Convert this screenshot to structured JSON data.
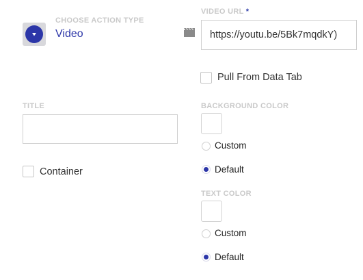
{
  "action_type": {
    "label": "CHOOSE ACTION TYPE",
    "value": "Video",
    "icon": "chevron-down-icon"
  },
  "video_url": {
    "label": "VIDEO URL",
    "required_marker": "*",
    "value": "https://youtu.be/5Bk7mqdkY)",
    "icon": "film-icon"
  },
  "pull_from_data_tab": {
    "label": "Pull From Data Tab",
    "checked": false
  },
  "title": {
    "label": "TITLE",
    "value": ""
  },
  "container": {
    "label": "Container",
    "checked": false
  },
  "background_color": {
    "label": "BACKGROUND COLOR",
    "options": [
      {
        "label": "Custom",
        "selected": false
      },
      {
        "label": "Default",
        "selected": true
      }
    ]
  },
  "text_color": {
    "label": "TEXT COLOR",
    "options": [
      {
        "label": "Custom",
        "selected": false
      },
      {
        "label": "Default",
        "selected": true
      }
    ]
  },
  "colors": {
    "accent": "#2c36a8",
    "label_gray": "#c9c9c9",
    "border": "#cfcfcf"
  }
}
